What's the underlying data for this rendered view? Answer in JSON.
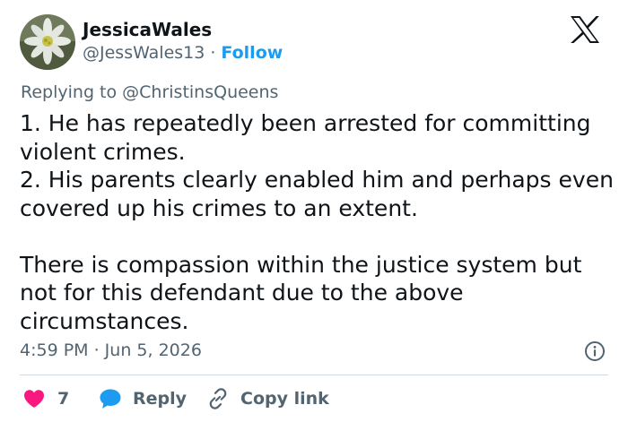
{
  "author": {
    "name": "JessicaWales",
    "handle": "@JessWales13",
    "separator": "·",
    "follow_label": "Follow"
  },
  "reply_to": {
    "prefix": "Replying to ",
    "mention": "@ChristinsQueens"
  },
  "tweet": {
    "lines": [
      "1. He has repeatedly been arrested for committing violent crimes.",
      "2. His parents clearly enabled him and perhaps even covered up his crimes to an extent.",
      "There is compassion within the justice system but not for this defendant due to the above circumstances."
    ]
  },
  "meta": {
    "timestamp": "4:59 PM · Jun 5, 2026"
  },
  "actions": {
    "like_count": "7",
    "reply_label": "Reply",
    "copy_label": "Copy link"
  },
  "icons": {
    "logo": "x-logo-icon",
    "like": "heart-icon",
    "reply": "speech-bubble-icon",
    "copy": "link-icon",
    "info": "info-icon"
  },
  "colors": {
    "text": "#0f1419",
    "muted": "#536471",
    "link": "#1d9bf0",
    "heart": "#f91880",
    "divider": "#cfd9de"
  }
}
